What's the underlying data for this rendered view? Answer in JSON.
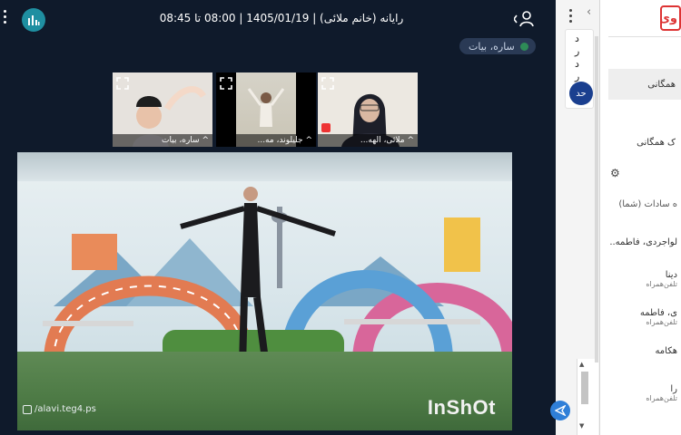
{
  "meeting": {
    "title": "رایانه (خانم ملائی) | 1405/01/19 | 08:00 تا 08:45",
    "speaker": "ساره، بیات",
    "thumbnails": [
      {
        "name": "ملائی، الهه...",
        "muted": true
      },
      {
        "name": "جلیلوند، مه...",
        "muted": false
      },
      {
        "name": "ساره، بیات",
        "muted": false
      }
    ],
    "video_watermark": "/alavi.teg4.ps",
    "video_brand": "InShOt"
  },
  "chat": {
    "chars": [
      "د",
      "ر",
      "د",
      "ر"
    ],
    "avatar": "حد"
  },
  "userlist": {
    "logo": "وی",
    "items": [
      {
        "label": "همگانی"
      },
      {
        "label": "ک همگانی"
      },
      {
        "label": "ه سادات (شما)"
      },
      {
        "label": "لواجردی، فاطمه.."
      },
      {
        "label": "دینا",
        "sub": "تلفن‌همراه"
      },
      {
        "label": "ی، فاطمه",
        "sub": "تلفن‌همراه"
      },
      {
        "label": "هکامه"
      },
      {
        "label": "را",
        "sub": "تلفن‌همراه"
      }
    ]
  },
  "colors": {
    "background": "#0f1a2b",
    "stats_button": "#1f8fa1",
    "send_button": "#2f7fd8",
    "chat_avatar": "#1a3f8f",
    "logo": "#d33333"
  }
}
